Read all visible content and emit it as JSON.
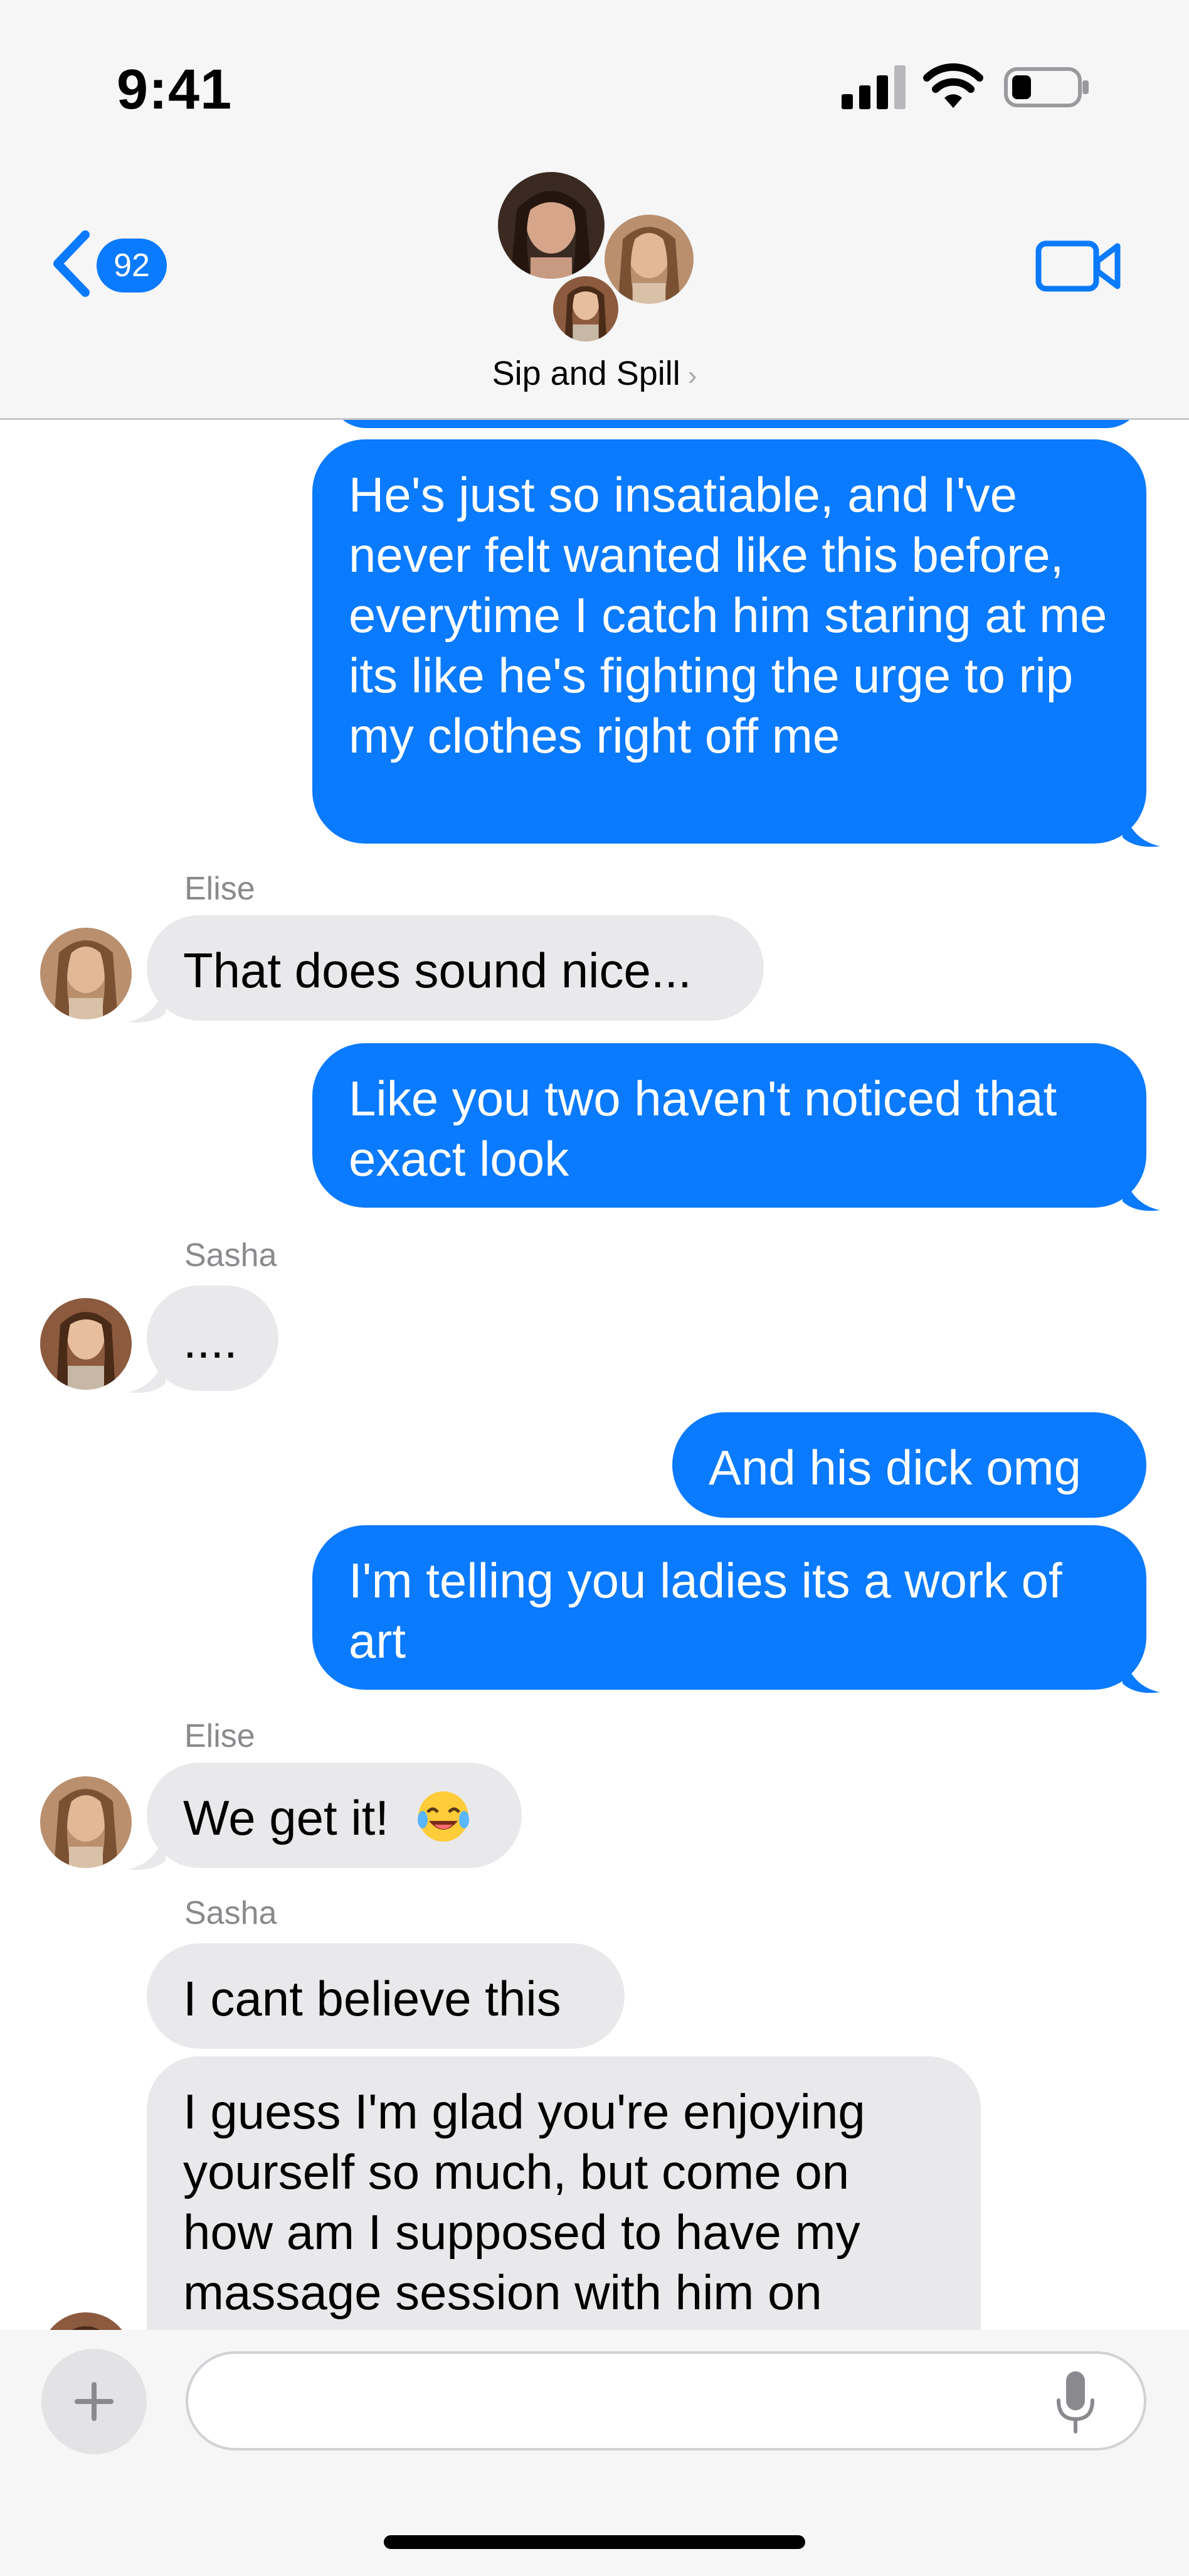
{
  "status_bar": {
    "time": "9:41"
  },
  "header": {
    "back_count": "92",
    "group_name": "Sip and Spill",
    "chevron": "›",
    "icons": [
      "chevron-left-icon",
      "video-camera-icon"
    ]
  },
  "messages": [
    {
      "direction": "out",
      "text": "He's just so insatiable, and I've never felt wanted like this before, everytime I catch him staring at me its like he's fighting the urge to rip my clothes right off me"
    },
    {
      "direction": "in",
      "sender": "Elise",
      "text": "That does sound nice..."
    },
    {
      "direction": "out",
      "text": "Like you two haven't noticed that exact look"
    },
    {
      "direction": "in",
      "sender": "Sasha",
      "text": "...."
    },
    {
      "direction": "out",
      "text": "And his dick omg"
    },
    {
      "direction": "out",
      "text": "I'm telling you ladies its a work of art"
    },
    {
      "direction": "in",
      "sender": "Elise",
      "text": "We get it!",
      "emoji": "face-with-tears-of-joy"
    },
    {
      "direction": "in",
      "sender": "Sasha",
      "text": "I cant believe this"
    },
    {
      "direction": "in",
      "sender": "Sasha",
      "text": "I guess I'm glad you're enjoying yourself so much, but come on how am I supposed to have my massage session with him on"
    }
  ],
  "input": {
    "placeholder": ""
  },
  "colors": {
    "outgoing": "#0a7aff",
    "incoming": "#e9e9eb",
    "sender_label": "#8a8a8e"
  }
}
